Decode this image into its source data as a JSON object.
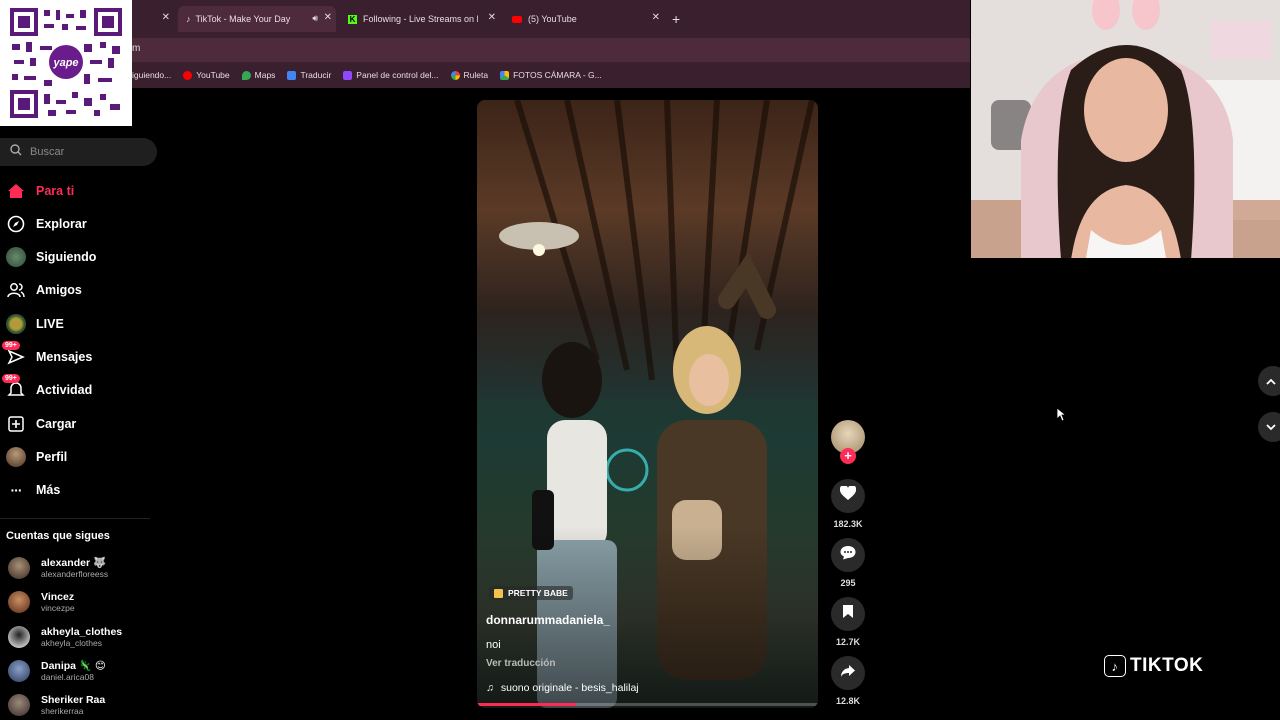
{
  "browser": {
    "tabs": [
      {
        "label": "",
        "has_close": true
      },
      {
        "label": "TikTok - Make Your Day",
        "has_close": true,
        "active": true
      },
      {
        "label": "Following - Live Streams on Kick",
        "has_close": true
      },
      {
        "label": "(5) YouTube",
        "has_close": true
      }
    ],
    "address_text": "m",
    "bookmarks": [
      {
        "label": "iguiendo...",
        "icon": "tiktok-icon",
        "color": "#ffffff"
      },
      {
        "label": "YouTube",
        "icon": "youtube-icon",
        "color": "#ff0000"
      },
      {
        "label": "Maps",
        "icon": "maps-icon",
        "color": "#34a853"
      },
      {
        "label": "Traducir",
        "icon": "translate-icon",
        "color": "#4285f4"
      },
      {
        "label": "Panel de control del...",
        "icon": "twitch-icon",
        "color": "#9146ff"
      },
      {
        "label": "Ruleta",
        "icon": "google-icon",
        "color": "#fbbc05"
      },
      {
        "label": "FOTOS CÁMARA - G...",
        "icon": "drive-icon",
        "color": "#34a853"
      }
    ]
  },
  "qr": {
    "brand": "yape"
  },
  "sidebar": {
    "search_placeholder": "Buscar",
    "nav": [
      {
        "label": "Para ti",
        "icon": "home-icon",
        "active": true
      },
      {
        "label": "Explorar",
        "icon": "compass-icon"
      },
      {
        "label": "Siguiendo",
        "icon": "following-avatar-icon"
      },
      {
        "label": "Amigos",
        "icon": "friends-icon"
      },
      {
        "label": "LIVE",
        "icon": "live-icon"
      },
      {
        "label": "Mensajes",
        "icon": "messages-icon",
        "badge": "99+"
      },
      {
        "label": "Actividad",
        "icon": "activity-icon",
        "badge": "99+"
      },
      {
        "label": "Cargar",
        "icon": "upload-icon"
      },
      {
        "label": "Perfil",
        "icon": "profile-avatar-icon"
      },
      {
        "label": "Más",
        "icon": "more-icon"
      }
    ],
    "following_title": "Cuentas que sigues",
    "accounts": [
      {
        "name": "alexander 🐺",
        "handle": "alexanderfloreess"
      },
      {
        "name": "Vincez",
        "handle": "vincezpe"
      },
      {
        "name": "akheyla_clothes",
        "handle": "akheyla_clothes"
      },
      {
        "name": "Danipa 🦎 😊",
        "handle": "daniel.arica08"
      },
      {
        "name": "Sheriker Raa",
        "handle": "sherikerraa"
      }
    ]
  },
  "video": {
    "tag": "PRETTY BABE",
    "username": "donnarummadaniela_",
    "caption": "noi",
    "translate": "Ver traducción",
    "sound": "suono originale - besis_halilaj",
    "progress": 0.29
  },
  "actions": {
    "likes": "182.3K",
    "comments": "295",
    "saves": "12.7K",
    "shares": "12.8K"
  },
  "watermark": "TIKTOK",
  "colors": {
    "accent": "#fe2c55",
    "chrome": "#3a1f2e"
  }
}
